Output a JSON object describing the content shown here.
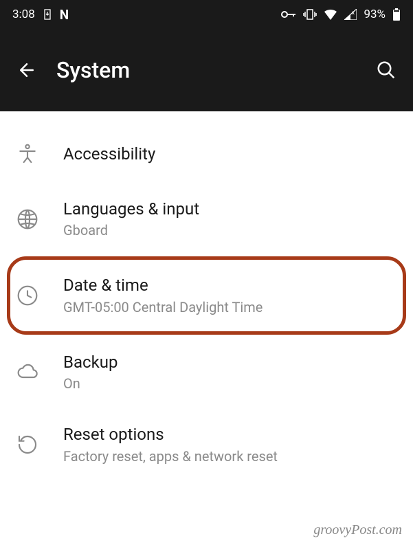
{
  "status": {
    "time": "3:08",
    "battery_pct": "93%"
  },
  "header": {
    "title": "System"
  },
  "items": {
    "accessibility": {
      "title": "Accessibility"
    },
    "languages": {
      "title": "Languages & input",
      "sub": "Gboard"
    },
    "date_time": {
      "title": "Date & time",
      "sub": "GMT-05:00 Central Daylight Time"
    },
    "backup": {
      "title": "Backup",
      "sub": "On"
    },
    "reset": {
      "title": "Reset options",
      "sub": "Factory reset, apps & network reset"
    }
  },
  "watermark": "groovyPost.com"
}
